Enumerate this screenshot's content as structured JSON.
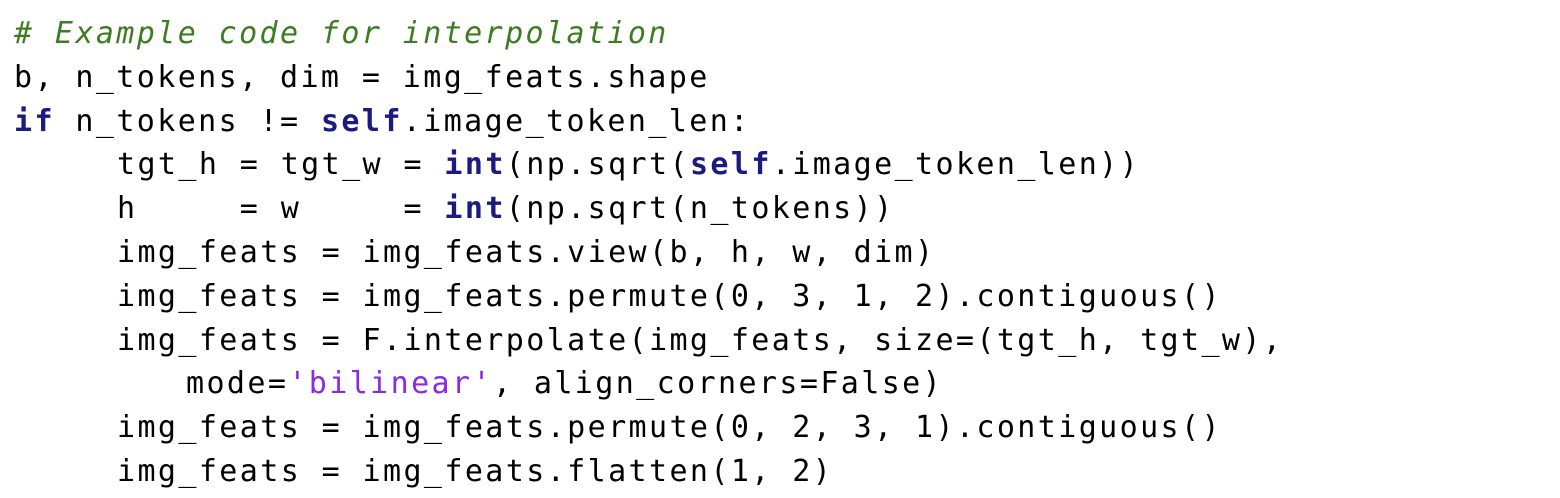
{
  "colors": {
    "comment": "#3c7d23",
    "keyword": "#1a1a80",
    "string": "#8a2be2",
    "text": "#000000"
  },
  "code": {
    "comment": "# Example code for interpolation",
    "line1": "b, n_tokens, dim = img_feats.shape",
    "line2": {
      "kw": "if",
      "a": " n_tokens != ",
      "self": "self",
      "b": ".image_token_len:"
    },
    "line3": {
      "a": "tgt_h = tgt_w = ",
      "int": "int",
      "b": "(np.sqrt(",
      "self": "self",
      "c": ".image_token_len))"
    },
    "line4": {
      "a": "h     = w     = ",
      "int": "int",
      "b": "(np.sqrt(n_tokens))"
    },
    "line5": "img_feats = img_feats.view(b, h, w, dim)",
    "line6": "img_feats = img_feats.permute(0, 3, 1, 2).contiguous()",
    "line7": "img_feats = F.interpolate(img_feats, size=(tgt_h, tgt_w),",
    "line8": {
      "a": "mode=",
      "str": "'bilinear'",
      "b": ", align_corners=False)"
    },
    "line9": "img_feats = img_feats.permute(0, 2, 3, 1).contiguous()",
    "line10": "img_feats = img_feats.flatten(1, 2)"
  }
}
